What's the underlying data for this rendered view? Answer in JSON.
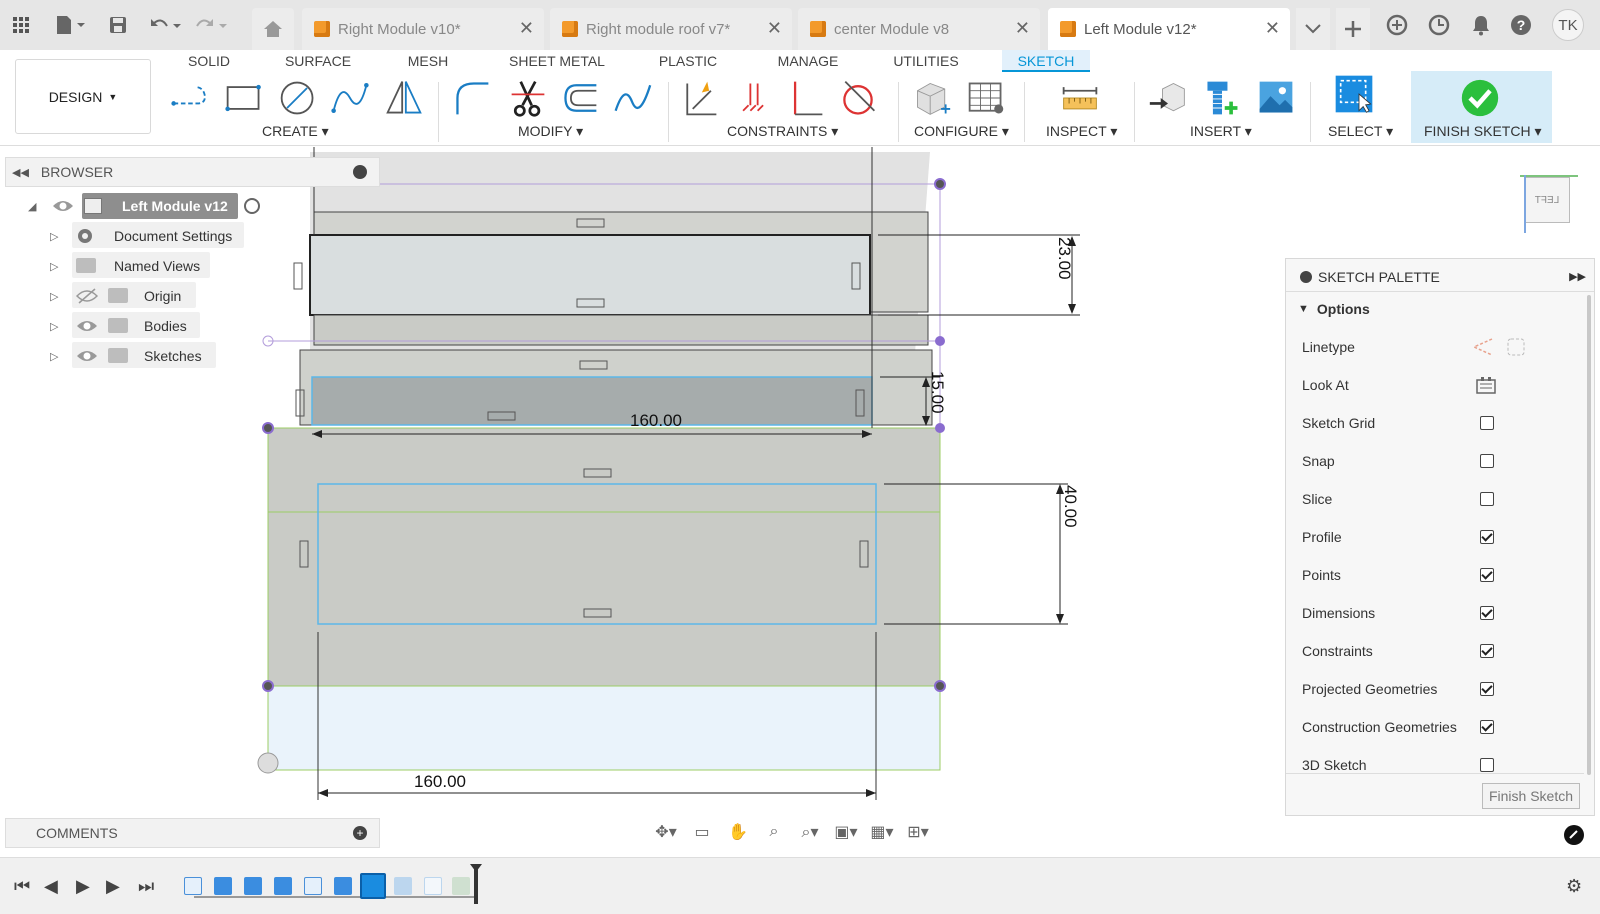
{
  "doc_tabs": [
    {
      "label": "Right Module v10*",
      "active": false
    },
    {
      "label": "Right module roof v7*",
      "active": false
    },
    {
      "label": "center Module v8",
      "active": false
    },
    {
      "label": "Left Module v12*",
      "active": true
    }
  ],
  "user_initials": "TK",
  "workspace": "DESIGN",
  "ribbon_tabs": [
    "SOLID",
    "SURFACE",
    "MESH",
    "SHEET METAL",
    "PLASTIC",
    "MANAGE",
    "UTILITIES",
    "SKETCH"
  ],
  "active_ribbon_tab": "SKETCH",
  "ribbon_groups": {
    "create": "CREATE",
    "modify": "MODIFY",
    "constraints": "CONSTRAINTS",
    "configure": "CONFIGURE",
    "inspect": "INSPECT",
    "insert": "INSERT",
    "select": "SELECT",
    "finish": "FINISH SKETCH"
  },
  "browser": {
    "title": "BROWSER",
    "root": "Left Module v12",
    "items": [
      "Document Settings",
      "Named Views",
      "Origin",
      "Bodies",
      "Sketches"
    ]
  },
  "dimensions": {
    "top_height": "23.00",
    "mid_height": "15.00",
    "mid_width": "160.00",
    "lower_height": "40.00",
    "bottom_width": "160.00"
  },
  "viewcube_label": "LEFT",
  "palette": {
    "title": "SKETCH PALETTE",
    "section": "Options",
    "linetype_label": "Linetype",
    "lookat_label": "Look At",
    "options": [
      {
        "label": "Sketch Grid",
        "checked": false
      },
      {
        "label": "Snap",
        "checked": false
      },
      {
        "label": "Slice",
        "checked": false
      },
      {
        "label": "Profile",
        "checked": true
      },
      {
        "label": "Points",
        "checked": true
      },
      {
        "label": "Dimensions",
        "checked": true
      },
      {
        "label": "Constraints",
        "checked": true
      },
      {
        "label": "Projected Geometries",
        "checked": true
      },
      {
        "label": "Construction Geometries",
        "checked": true
      },
      {
        "label": "3D Sketch",
        "checked": false
      }
    ],
    "finish_button": "Finish Sketch"
  },
  "comments_title": "COMMENTS",
  "colors": {
    "accent": "#0696d7",
    "finish_green": "#2bbf3d",
    "sketch_purple": "#8a6ccf",
    "profile_blue": "#5cb7e8",
    "construction_green": "#9ccc65",
    "body_grey": "#c9cbc6"
  }
}
